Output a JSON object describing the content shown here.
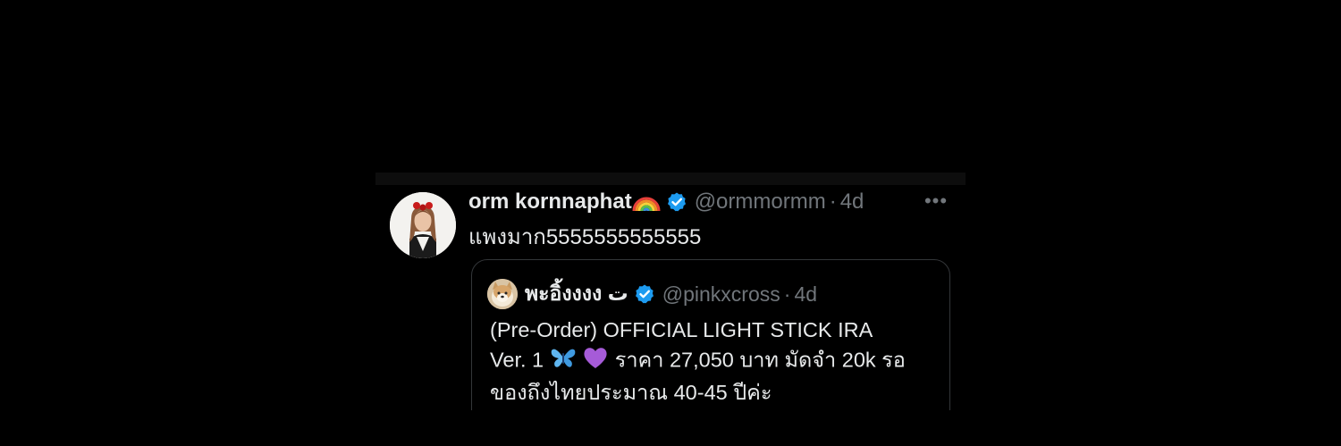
{
  "tweet": {
    "display_name": "orm kornnaphat",
    "name_emoji": "rainbow-icon",
    "handle": "@ormmormm",
    "separator": "·",
    "time": "4d",
    "more": "•••",
    "text": "แพงมาก5555555555555"
  },
  "quoted_tweet": {
    "display_name": "พะอิ้งงงง ت",
    "handle": "@pinkxcross",
    "separator": "·",
    "time": "4d",
    "line1": "(Pre-Order) OFFICIAL LIGHT STICK IRA",
    "line2_before": "Ver. 1",
    "line2_emojis": [
      "butterfly-icon",
      "purple-heart-icon"
    ],
    "line2_after": "ราคา 27,050 บาท มัดจำ 20k รอ",
    "line3": "ของถึงไทยประมาณ 40-45 ปีค่ะ"
  },
  "colors": {
    "background": "#000000",
    "text_primary": "#e7e9ea",
    "text_secondary": "#71767b",
    "verified_blue": "#1d9bf0",
    "quote_border": "#333639"
  }
}
